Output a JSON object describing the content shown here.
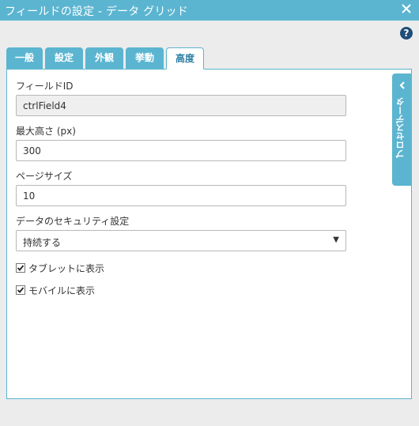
{
  "window": {
    "title": "フィールドの設定 - データ グリッド",
    "close_icon": "close-icon"
  },
  "help": {
    "label": "?"
  },
  "tabs": [
    {
      "label": "一般"
    },
    {
      "label": "設定"
    },
    {
      "label": "外観"
    },
    {
      "label": "挙動"
    },
    {
      "label": "高度",
      "active": true
    }
  ],
  "fields": {
    "field_id": {
      "label": "フィールドID",
      "value": "ctrlField4"
    },
    "max_height": {
      "label": "最大高さ (px)",
      "value": "300"
    },
    "page_size": {
      "label": "ページサイズ",
      "value": "10"
    },
    "data_security": {
      "label": "データのセキュリティ設定",
      "selected": "持続する"
    }
  },
  "checkboxes": {
    "show_on_tablet": {
      "label": "タブレットに表示",
      "checked": true
    },
    "show_on_mobile": {
      "label": "モバイルに表示",
      "checked": true
    }
  },
  "side_panel": {
    "label": "プロセスデータ"
  },
  "colors": {
    "accent": "#5bb5d0",
    "help": "#1f4e79",
    "background": "#ececec"
  }
}
